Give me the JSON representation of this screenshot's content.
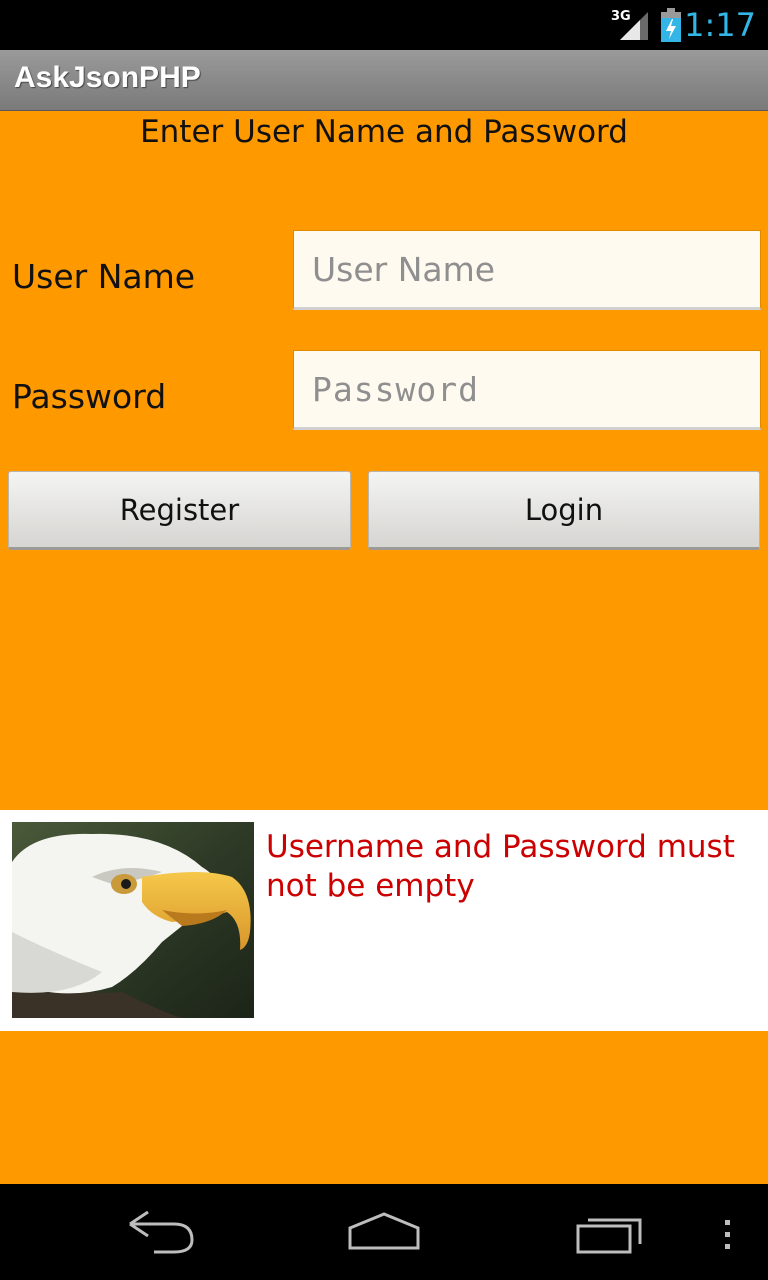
{
  "status_bar": {
    "network": "3G",
    "time": "1:17",
    "signal_icon": "signal-icon",
    "battery_icon": "battery-charging-icon"
  },
  "app": {
    "title": "AskJsonPHP"
  },
  "form": {
    "heading": "Enter User Name and Password",
    "username_label": "User Name",
    "username_placeholder": "User Name",
    "username_value": "",
    "password_label": "Password",
    "password_placeholder": "Password",
    "password_value": "",
    "register_label": "Register",
    "login_label": "Login"
  },
  "message": {
    "image_icon": "eagle-image",
    "text": "Username and Password must not be empty",
    "text_color": "#cc0000"
  },
  "nav_bar": {
    "back_icon": "back-icon",
    "home_icon": "home-icon",
    "recent_icon": "recent-apps-icon",
    "menu_icon": "overflow-menu-icon"
  },
  "colors": {
    "background": "#ff9900",
    "status_time": "#33b5e5"
  }
}
